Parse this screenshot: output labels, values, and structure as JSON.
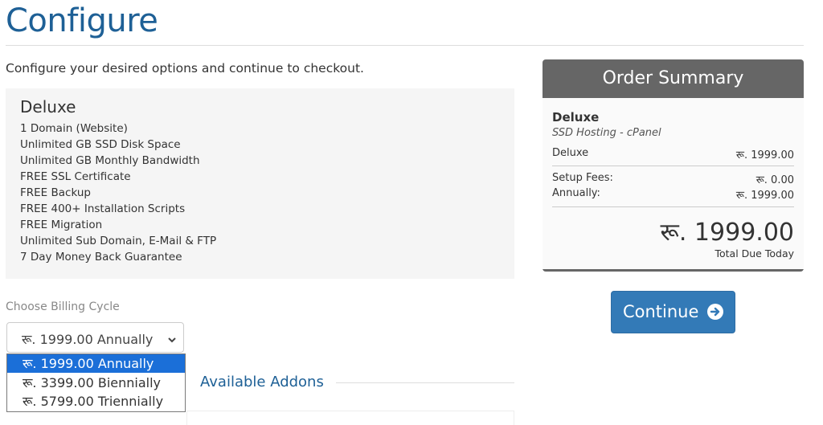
{
  "page": {
    "title": "Configure",
    "intro": "Configure your desired options and continue to checkout."
  },
  "product": {
    "name": "Deluxe",
    "features": [
      "1 Domain (Website)",
      "Unlimited GB SSD Disk Space",
      "Unlimited GB Monthly Bandwidth",
      "FREE SSL Certificate",
      "FREE Backup",
      "FREE 400+ Installation Scripts",
      "FREE Migration",
      "Unlimited Sub Domain, E-Mail & FTP",
      "7 Day Money Back Guarantee"
    ]
  },
  "billing": {
    "label": "Choose Billing Cycle",
    "selected": "रू. 1999.00 Annually",
    "options": [
      "रू. 1999.00 Annually",
      "रू. 3399.00 Biennially",
      "रू. 5799.00 Triennially"
    ]
  },
  "addons": {
    "title": "Available Addons"
  },
  "summary": {
    "header": "Order Summary",
    "product_name": "Deluxe",
    "product_group": "SSD Hosting - cPanel",
    "line_label": "Deluxe",
    "line_value": "रू. 1999.00",
    "setup_label": "Setup Fees:",
    "setup_value": "रू. 0.00",
    "cycle_label": "Annually:",
    "cycle_value": "रू. 1999.00",
    "total": "रू. 1999.00",
    "total_label": "Total Due Today"
  },
  "actions": {
    "continue_label": "Continue",
    "continue_icon": "arrow-circle-right-icon"
  },
  "colors": {
    "title": "#1e6096",
    "summary_header": "#666666",
    "button": "#337ab7",
    "dropdown_selected": "#1b6fd8"
  }
}
